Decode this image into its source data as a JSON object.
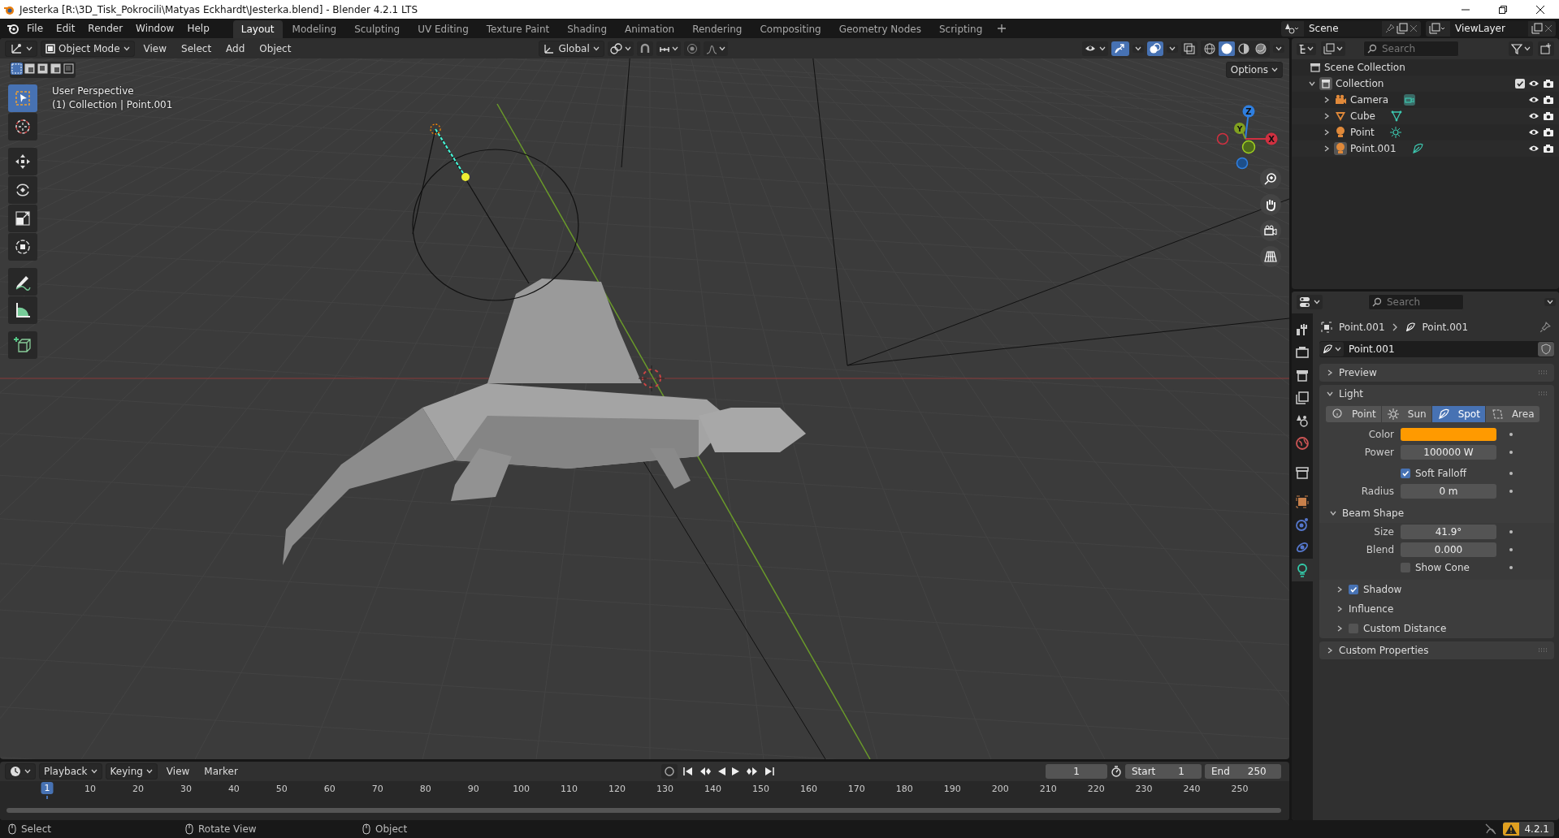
{
  "window": {
    "title": "Jesterka [R:\\3D_Tisk_Pokrocili\\Matyas Eckhardt\\Jesterka.blend] - Blender 4.2.1 LTS"
  },
  "menu": [
    "File",
    "Edit",
    "Render",
    "Window",
    "Help"
  ],
  "workspaces": [
    {
      "label": "Layout",
      "selected": true
    },
    {
      "label": "Modeling",
      "selected": false
    },
    {
      "label": "Sculpting",
      "selected": false
    },
    {
      "label": "UV Editing",
      "selected": false
    },
    {
      "label": "Texture Paint",
      "selected": false
    },
    {
      "label": "Shading",
      "selected": false
    },
    {
      "label": "Animation",
      "selected": false
    },
    {
      "label": "Rendering",
      "selected": false
    },
    {
      "label": "Compositing",
      "selected": false
    },
    {
      "label": "Geometry Nodes",
      "selected": false
    },
    {
      "label": "Scripting",
      "selected": false
    }
  ],
  "scene": "Scene",
  "view_layer": "ViewLayer",
  "viewport": {
    "mode": "Object Mode",
    "menus": [
      "View",
      "Select",
      "Add",
      "Object"
    ],
    "orientation": "Global",
    "options": "Options",
    "select_modes": [
      {
        "selected": true
      },
      {
        "selected": false
      },
      {
        "selected": false
      },
      {
        "selected": false
      },
      {
        "selected": false
      }
    ],
    "shading": [
      {
        "kind": "wireframe",
        "selected": false
      },
      {
        "kind": "solid",
        "selected": true
      },
      {
        "kind": "material",
        "selected": false
      },
      {
        "kind": "rendered",
        "selected": false
      }
    ],
    "view_name": "User Perspective",
    "context": "(1) Collection | Point.001",
    "tools": [
      {
        "kind": "select",
        "selected": true
      },
      {
        "kind": "cursor",
        "selected": false
      },
      {
        "kind": "move",
        "selected": false
      },
      {
        "kind": "rotate",
        "selected": false
      },
      {
        "kind": "scale",
        "selected": false
      },
      {
        "kind": "transform",
        "selected": false
      },
      {
        "kind": "annotate",
        "selected": false
      },
      {
        "kind": "measure",
        "selected": false
      },
      {
        "kind": "add_cube",
        "selected": false
      }
    ],
    "gizmo_axes": [
      "Z",
      "Y",
      "X"
    ]
  },
  "outliner": {
    "placeholder": "Search",
    "root": "Scene Collection",
    "collections": [
      {
        "label": "Collection",
        "expanded": true,
        "checked": true,
        "children": [
          {
            "label": "Camera",
            "kind": "camera",
            "expanded": false,
            "active": false
          },
          {
            "label": "Cube",
            "kind": "mesh",
            "expanded": false,
            "active": false
          },
          {
            "label": "Point",
            "kind": "point_light",
            "expanded": false,
            "active": false
          },
          {
            "label": "Point.001",
            "kind": "spot_light",
            "expanded": false,
            "active": true
          }
        ]
      }
    ]
  },
  "properties": {
    "placeholder": "Search",
    "tabs": [
      {
        "kind": "tool",
        "selected": false
      },
      {
        "kind": "render",
        "selected": false
      },
      {
        "kind": "output",
        "selected": false
      },
      {
        "kind": "view_layer",
        "selected": false
      },
      {
        "kind": "scene",
        "selected": false
      },
      {
        "kind": "world",
        "selected": false
      },
      {
        "kind": "collection",
        "selected": false
      },
      {
        "kind": "object",
        "selected": false
      },
      {
        "kind": "physics",
        "selected": false
      },
      {
        "kind": "constraints",
        "selected": false
      },
      {
        "kind": "light",
        "selected": true
      }
    ],
    "breadcrumb": [
      "Point.001",
      "Point.001"
    ],
    "datablock": "Point.001",
    "preview": {
      "label": "Preview",
      "expanded": false
    },
    "light": {
      "label": "Light",
      "expanded": true,
      "types": [
        {
          "label": "Point",
          "kind": "point",
          "selected": false
        },
        {
          "label": "Sun",
          "kind": "sun",
          "selected": false
        },
        {
          "label": "Spot",
          "kind": "spot",
          "selected": true
        },
        {
          "label": "Area",
          "kind": "area",
          "selected": false
        }
      ],
      "color": {
        "label": "Color",
        "color": "#ff9a00"
      },
      "power": {
        "label": "Power",
        "value": "100000 W"
      },
      "soft_falloff": {
        "label": "Soft Falloff",
        "checked": true
      },
      "radius": {
        "label": "Radius",
        "value": "0 m"
      },
      "beam_shape": {
        "label": "Beam Shape",
        "expanded": true,
        "size": {
          "label": "Size",
          "value": "41.9°"
        },
        "blend": {
          "label": "Blend",
          "value": "0.000"
        },
        "show_cone": {
          "label": "Show Cone",
          "checked": false
        }
      },
      "subpanels": [
        {
          "label": "Shadow",
          "expanded": false,
          "checked": true
        },
        {
          "label": "Influence",
          "expanded": false
        },
        {
          "label": "Custom Distance",
          "expanded": false,
          "checked": false
        }
      ]
    },
    "custom_properties": {
      "label": "Custom Properties",
      "expanded": false
    }
  },
  "timeline": {
    "menus": [
      "Playback",
      "Keying",
      "View",
      "Marker"
    ],
    "current_frame": "1",
    "start_label": "Start",
    "start": "1",
    "end_label": "End",
    "end": "250",
    "ruler": [
      "1",
      "10",
      "20",
      "30",
      "40",
      "50",
      "60",
      "70",
      "80",
      "90",
      "100",
      "110",
      "120",
      "130",
      "140",
      "150",
      "160",
      "170",
      "180",
      "190",
      "200",
      "210",
      "220",
      "230",
      "240",
      "250"
    ]
  },
  "status_bar": {
    "hints": [
      "Select",
      "Rotate View",
      "Object"
    ],
    "version": "4.2.1"
  }
}
